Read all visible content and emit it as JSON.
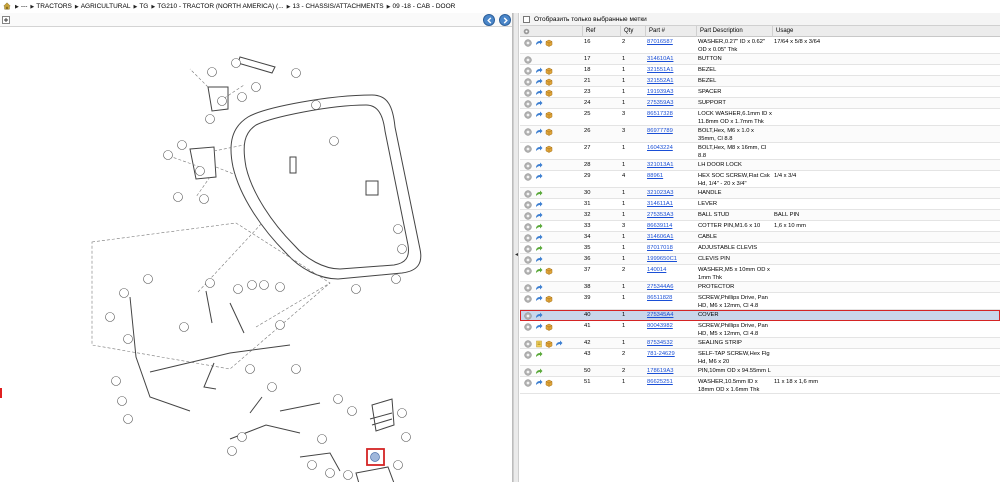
{
  "breadcrumb": {
    "items": [
      "---",
      "TRACTORS",
      "AGRICULTURAL",
      "TG",
      "TG210 - TRACTOR (NORTH AMERICA) (...",
      "13 - CHASSIS/ATTACHMENTS",
      "09 -18 - CAB - DOOR"
    ]
  },
  "filter": {
    "label": "Отобразить только выбранные метки",
    "checked": false
  },
  "table": {
    "headers": [
      "Ref",
      "Qty",
      "Part #",
      "Part Description",
      "Usage"
    ],
    "selected_ref": "40",
    "rows": [
      {
        "ref": "16",
        "qty": "2",
        "part": "87016587",
        "desc": "WASHER,0.27\" ID x 0.62\" OD x 0.05\" Thk",
        "usage": "17/64 x 5/8 x 3/64",
        "icons": [
          "info",
          "arrow-blue",
          "box"
        ]
      },
      {
        "ref": "17",
        "qty": "1",
        "part": "314610A1",
        "desc": "BUTTON",
        "usage": "",
        "icons": [
          "info"
        ]
      },
      {
        "ref": "18",
        "qty": "1",
        "part": "321551A1",
        "desc": "BEZEL",
        "usage": "",
        "icons": [
          "info",
          "arrow-blue",
          "box"
        ]
      },
      {
        "ref": "21",
        "qty": "1",
        "part": "321552A1",
        "desc": "BEZEL",
        "usage": "",
        "icons": [
          "info",
          "arrow-blue",
          "box"
        ]
      },
      {
        "ref": "23",
        "qty": "1",
        "part": "191939A3",
        "desc": "SPACER",
        "usage": "",
        "icons": [
          "info",
          "arrow-blue",
          "box"
        ]
      },
      {
        "ref": "24",
        "qty": "1",
        "part": "275359A3",
        "desc": "SUPPORT",
        "usage": "",
        "icons": [
          "info",
          "arrow-blue"
        ]
      },
      {
        "ref": "25",
        "qty": "3",
        "part": "86517328",
        "desc": "LOCK WASHER,6.1mm ID x 11.8mm OD x 1.7mm Thk",
        "usage": "",
        "icons": [
          "info",
          "arrow-blue",
          "box"
        ]
      },
      {
        "ref": "26",
        "qty": "3",
        "part": "86977789",
        "desc": "BOLT,Hex, M6 x 1.0 x 35mm, Cl 8.8",
        "usage": "",
        "icons": [
          "info",
          "arrow-blue",
          "box"
        ]
      },
      {
        "ref": "27",
        "qty": "1",
        "part": "16043224",
        "desc": "BOLT,Hex, M8 x 16mm, Cl 8.8",
        "usage": "",
        "icons": [
          "info",
          "arrow-blue",
          "box"
        ]
      },
      {
        "ref": "28",
        "qty": "1",
        "part": "321013A1",
        "desc": "LH DOOR LOCK",
        "usage": "",
        "icons": [
          "info",
          "arrow-blue"
        ]
      },
      {
        "ref": "29",
        "qty": "4",
        "part": "88961",
        "desc": "HEX SOC SCREW,Flat Csk Hd, 1/4\" - 20 x 3/4\"",
        "usage": "1/4 x 3/4",
        "icons": [
          "info",
          "arrow-blue"
        ]
      },
      {
        "ref": "30",
        "qty": "1",
        "part": "321023A3",
        "desc": "HANDLE",
        "usage": "",
        "icons": [
          "info",
          "arrow-green"
        ]
      },
      {
        "ref": "31",
        "qty": "1",
        "part": "314611A1",
        "desc": "LEVER",
        "usage": "",
        "icons": [
          "info",
          "arrow-blue"
        ]
      },
      {
        "ref": "32",
        "qty": "1",
        "part": "275353A3",
        "desc": "BALL STUD",
        "usage": "BALL PIN",
        "icons": [
          "info",
          "arrow-blue"
        ]
      },
      {
        "ref": "33",
        "qty": "3",
        "part": "86639114",
        "desc": "COTTER PIN,M1.6 x 10",
        "usage": "1,6 x 10 mm",
        "icons": [
          "info",
          "arrow-green"
        ]
      },
      {
        "ref": "34",
        "qty": "1",
        "part": "314606A1",
        "desc": "CABLE",
        "usage": "",
        "icons": [
          "info",
          "arrow-blue"
        ]
      },
      {
        "ref": "35",
        "qty": "1",
        "part": "87017018",
        "desc": "ADJUSTABLE CLEVIS",
        "usage": "",
        "icons": [
          "info",
          "arrow-green"
        ]
      },
      {
        "ref": "36",
        "qty": "1",
        "part": "1999650C1",
        "desc": "CLEVIS PIN",
        "usage": "",
        "icons": [
          "info",
          "arrow-blue"
        ]
      },
      {
        "ref": "37",
        "qty": "2",
        "part": "140014",
        "desc": "WASHER,M5 x 10mm OD x 1mm Thk",
        "usage": "",
        "icons": [
          "info",
          "arrow-green",
          "box"
        ]
      },
      {
        "ref": "38",
        "qty": "1",
        "part": "275344A6",
        "desc": "PROTECTOR",
        "usage": "",
        "icons": [
          "info",
          "arrow-blue"
        ]
      },
      {
        "ref": "39",
        "qty": "1",
        "part": "86511828",
        "desc": "SCREW,Phillips Drive, Pan HD, M6 x 12mm, Cl 4.8",
        "usage": "",
        "icons": [
          "info",
          "arrow-blue",
          "box"
        ]
      },
      {
        "ref": "40",
        "qty": "1",
        "part": "275345A4",
        "desc": "COVER",
        "usage": "",
        "icons": [
          "info",
          "arrow-blue"
        ]
      },
      {
        "ref": "41",
        "qty": "1",
        "part": "80043982",
        "desc": "SCREW,Phillips Drive, Pan HD, M5 x 12mm, Cl 4.8",
        "usage": "",
        "icons": [
          "info",
          "arrow-blue",
          "box"
        ]
      },
      {
        "ref": "42",
        "qty": "1",
        "part": "87534532",
        "desc": "SEALING STRIP",
        "usage": "",
        "icons": [
          "info",
          "note",
          "box",
          "arrow-blue"
        ]
      },
      {
        "ref": "43",
        "qty": "2",
        "part": "781-24629",
        "desc": "SELF-TAP SCREW,Hex Flg Hd, M6 x 20",
        "usage": "",
        "icons": [
          "info",
          "arrow-green"
        ]
      },
      {
        "ref": "50",
        "qty": "2",
        "part": "178619A3",
        "desc": "PIN,10mm OD x 94.55mm L",
        "usage": "",
        "icons": [
          "info",
          "arrow-green"
        ]
      },
      {
        "ref": "51",
        "qty": "1",
        "part": "86625251",
        "desc": "WASHER,10.5mm ID x 18mm OD x 1.6mm Thk",
        "usage": "11 x 18 x 1,6 mm",
        "icons": [
          "info",
          "arrow-blue",
          "box"
        ]
      }
    ]
  },
  "colors": {
    "link": "#1a4fd6",
    "selection": "#c9d6ea",
    "highlight": "#d42424",
    "nav_button": "#4a86c9"
  }
}
